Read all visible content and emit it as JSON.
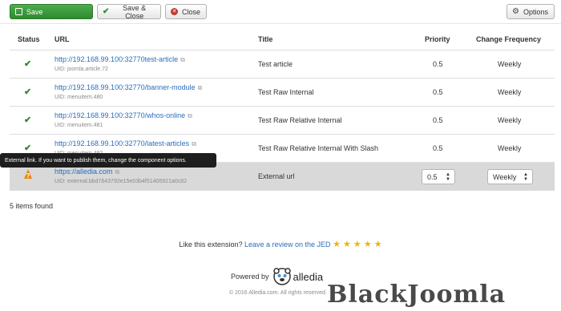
{
  "toolbar": {
    "save_label": "Save",
    "save_close_label": "Save & Close",
    "close_label": "Close",
    "options_label": "Options"
  },
  "table": {
    "headers": {
      "status": "Status",
      "url": "URL",
      "title": "Title",
      "priority": "Priority",
      "frequency": "Change Frequency"
    },
    "rows": [
      {
        "url": "http://192.168.99.100:32770test-article",
        "uid": "UID: joomla.article.72",
        "title": "Test article",
        "priority": "0.5",
        "frequency": "Weekly"
      },
      {
        "url": "http://192.168.99.100:32770/banner-module",
        "uid": "UID: menuitem.480",
        "title": "Test Raw Internal",
        "priority": "0.5",
        "frequency": "Weekly"
      },
      {
        "url": "http://192.168.99.100:32770/whos-online",
        "uid": "UID: menuitem.481",
        "title": "Test Raw Relative Internal",
        "priority": "0.5",
        "frequency": "Weekly"
      },
      {
        "url": "http://192.168.99.100:32770/latest-articles",
        "uid": "UID: menuitem.482",
        "title": "Test Raw Relative Internal With Slash",
        "priority": "0.5",
        "frequency": "Weekly"
      },
      {
        "url": "https://alledia.com",
        "uid": "UID: external.bbd7643792e15e03b4f51406921a0c82",
        "title": "External url",
        "priority": "0.5",
        "frequency": "Weekly"
      }
    ]
  },
  "tooltip": "External link. If you want to publish them, change the component options.",
  "items_found": "5 items found",
  "footer": {
    "like_text": "Like this extension?",
    "review_link": "Leave a review on the JED",
    "stars": "★ ★ ★ ★ ★",
    "powered_by": "Powered by",
    "brand": "alledia",
    "copyright": "© 2016 Alledia.com. All rights reserved.",
    "watermark": "BlackJoomla"
  },
  "colors": {
    "save_green": "#3f9f3f",
    "link_blue": "#2a6ebb",
    "check_green": "#2e8b2e",
    "star_gold": "#f0b400",
    "warning_orange": "#e8890c"
  }
}
